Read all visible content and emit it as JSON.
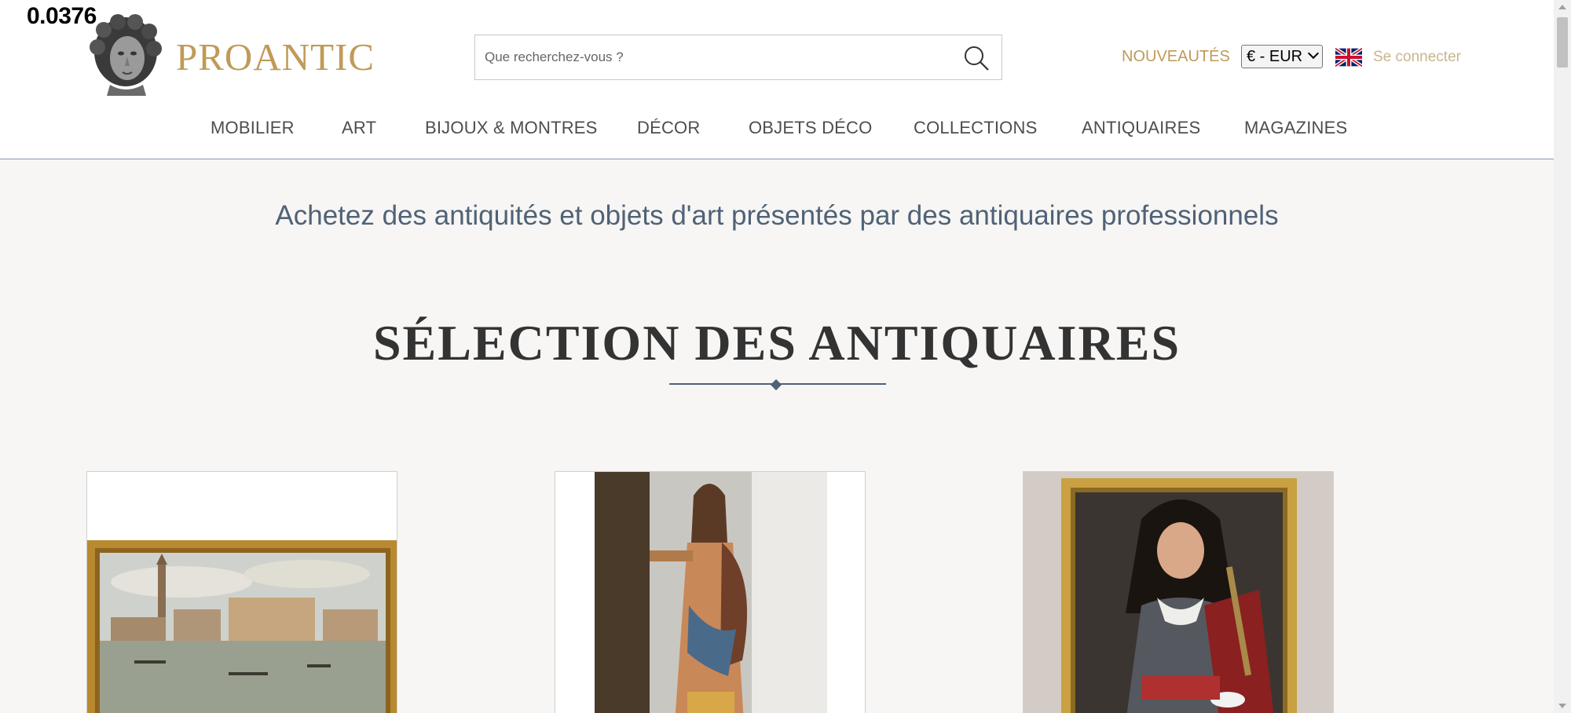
{
  "debug": {
    "counter": "0.0376"
  },
  "brand": {
    "name": "PROANTIC"
  },
  "search": {
    "placeholder": "Que recherchez-vous ?"
  },
  "header": {
    "nouveautes_label": "NOUVEAUTÉS",
    "currency_selected": "€ - EUR",
    "login_label": "Se connecter"
  },
  "nav": {
    "items": [
      {
        "label": "MOBILIER"
      },
      {
        "label": "ART"
      },
      {
        "label": "BIJOUX & MONTRES"
      },
      {
        "label": "DÉCOR"
      },
      {
        "label": "OBJETS DÉCO"
      },
      {
        "label": "COLLECTIONS"
      },
      {
        "label": "ANTIQUAIRES"
      },
      {
        "label": "MAGAZINES"
      }
    ]
  },
  "main": {
    "tagline": "Achetez des antiquités et objets d'art présentés par des antiquaires professionnels",
    "section_title": "SÉLECTION DES ANTIQUAIRES"
  },
  "colors": {
    "brand_gold": "#c09a58",
    "slate_blue": "#4f6277",
    "page_bg": "#f7f6f4"
  },
  "icons": {
    "search": "search-icon",
    "flag": "uk-flag-icon",
    "logo": "bust-logo-icon"
  }
}
